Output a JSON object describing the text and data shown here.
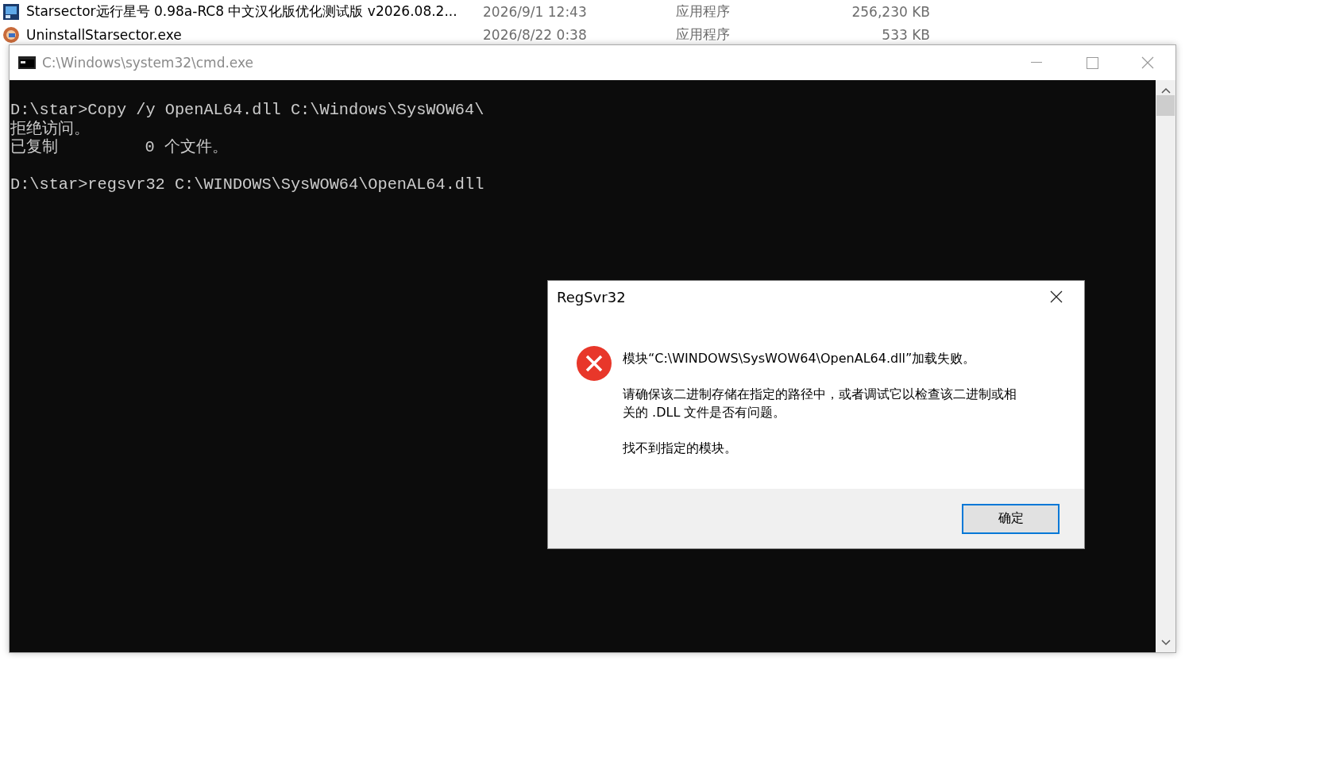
{
  "explorer_rows": [
    {
      "name": "Starsector远行星号 0.98a-RC8 中文汉化版优化测试版 v2026.08.2...",
      "date": "2026/9/1 12:43",
      "type": "应用程序",
      "size": "256,230 KB",
      "kind": "game"
    },
    {
      "name": "UninstallStarsector.exe",
      "date": "2026/8/22 0:38",
      "type": "应用程序",
      "size": "533 KB",
      "kind": "uninstall"
    }
  ],
  "console": {
    "title": "C:\\Windows\\system32\\cmd.exe",
    "blocks": [
      [
        "D:\\star>Copy /y OpenAL64.dll C:\\Windows\\SysWOW64\\",
        "拒绝访问。",
        "已复制         0 个文件。"
      ],
      [
        "D:\\star>regsvr32 C:\\WINDOWS\\SysWOW64\\OpenAL64.dll"
      ]
    ]
  },
  "dialog": {
    "title": "RegSvr32",
    "messages": [
      "模块“C:\\WINDOWS\\SysWOW64\\OpenAL64.dll”加载失败。",
      "请确保该二进制存储在指定的路径中，或者调试它以检查该二进制或相关的 .DLL 文件是否有问题。",
      "找不到指定的模块。"
    ],
    "button": "确定"
  }
}
